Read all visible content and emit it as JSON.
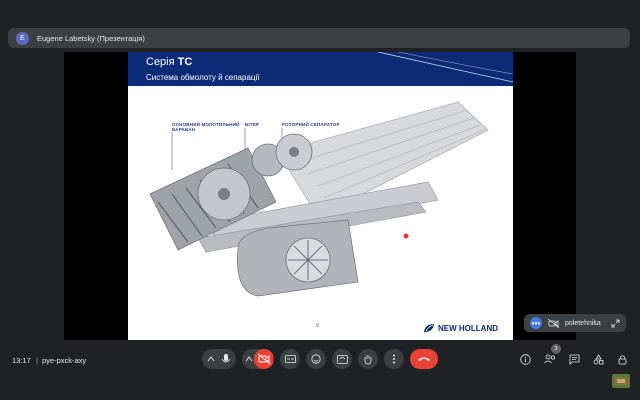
{
  "presenter_bar": {
    "avatar_letter": "E",
    "label": "Eugene Labetsky (Презентація)"
  },
  "slide": {
    "title_prefix": "Серія ",
    "title_model": "TC",
    "subtitle": "Система обмолоту й сепарації",
    "label_drum": "ОСНОВНИЙ МОЛОТИЛЬНИЙ БАРАБАН",
    "label_beater": "БІТЕР",
    "label_rotor": "РОТОРНИЙ СЕПАРАТОР",
    "page_number": "9",
    "logo_text": "NEW HOLLAND",
    "colors": {
      "header": "#0b2a78",
      "accent": "#1f3a8a"
    }
  },
  "participant_tile": {
    "name": "poletehnika"
  },
  "meeting": {
    "time": "13:17",
    "separator": "|",
    "code": "pye-pxck-axy"
  },
  "controls": {
    "mic_badge": "",
    "people_count": "3",
    "end_color": "#ea4335"
  }
}
